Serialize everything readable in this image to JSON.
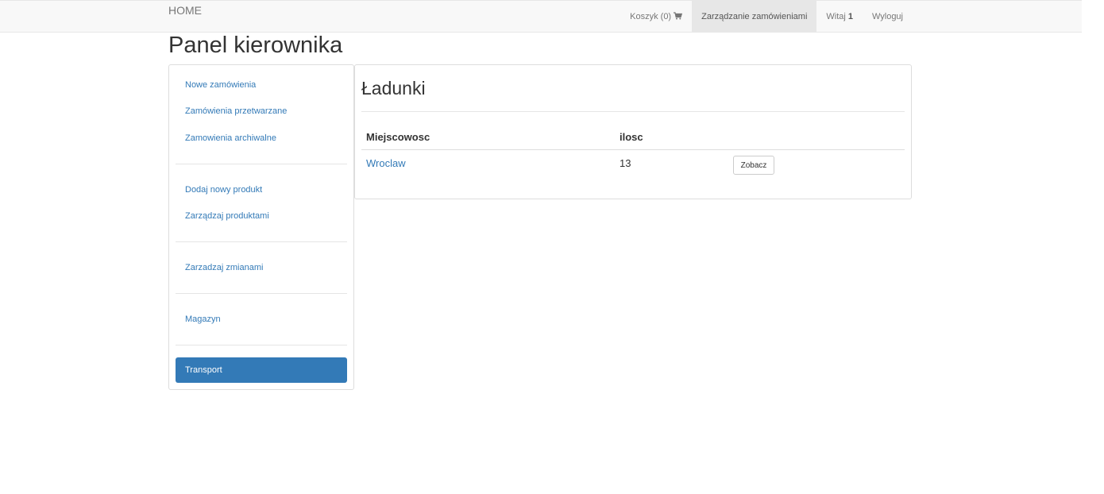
{
  "navbar": {
    "brand": "HOME",
    "cart_label": "Koszyk (0)",
    "cart_icon": "shopping-cart-icon",
    "manage_orders": "Zarządzanie zamówieniami",
    "greeting": "Witaj",
    "username": "1",
    "logout": "Wyloguj"
  },
  "page": {
    "title": "Panel kierownika"
  },
  "sidebar": {
    "groups": [
      [
        "Nowe zamówienia",
        "Zamówienia przetwarzane",
        "Zamowienia archiwalne"
      ],
      [
        "Dodaj nowy produkt",
        "Zarządzaj produktami"
      ],
      [
        "Zarzadzaj zmianami"
      ],
      [
        "Magazyn"
      ]
    ],
    "active_item": "Transport"
  },
  "content": {
    "heading": "Ładunki",
    "table": {
      "headers": [
        "Miejscowosc",
        "ilosc"
      ],
      "rows": [
        {
          "city": "Wroclaw",
          "qty": "13",
          "action": "Zobacz"
        }
      ]
    }
  },
  "colors": {
    "link": "#337ab7",
    "active_bg": "#337ab7",
    "navbar_bg": "#f8f8f8"
  }
}
